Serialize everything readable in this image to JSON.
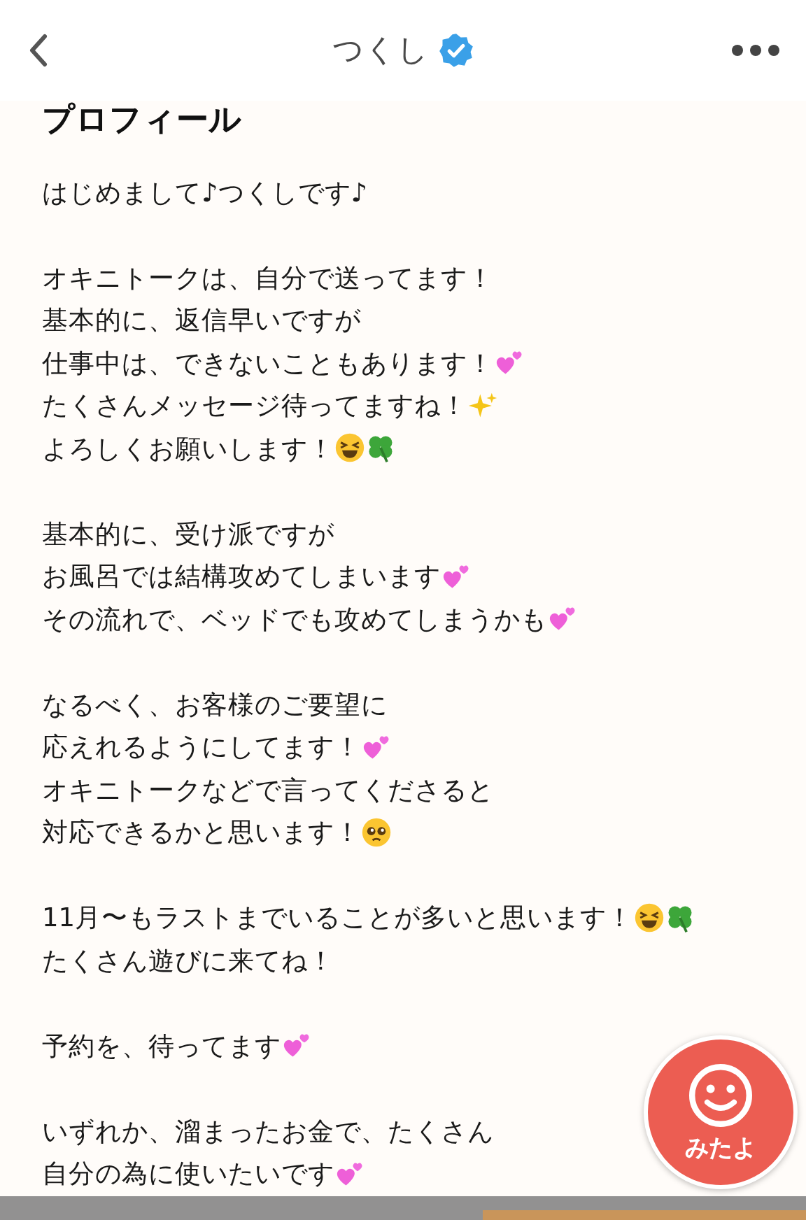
{
  "header": {
    "title": "つくし",
    "verified": true
  },
  "profile": {
    "heading": "プロフィール",
    "paragraphs": [
      [
        {
          "text": "はじめまして♪つくしです♪"
        }
      ],
      [
        {
          "text": "オキニトークは、自分で送ってます！"
        },
        {
          "text": "基本的に、返信早いですが"
        },
        {
          "text": "仕事中は、できないこともあります！",
          "icons": [
            {
              "kind": "hearts"
            }
          ]
        },
        {
          "text": "たくさんメッセージ待ってますね！",
          "icons": [
            {
              "kind": "sparkles"
            }
          ]
        },
        {
          "text": "よろしくお願いします！",
          "icons": [
            {
              "kind": "laugh"
            },
            {
              "kind": "clover"
            }
          ]
        }
      ],
      [
        {
          "text": "基本的に、受け派ですが"
        },
        {
          "text": "お風呂では結構攻めてしまいます",
          "icons": [
            {
              "kind": "hearts"
            }
          ]
        },
        {
          "text": "その流れで、ベッドでも攻めてしまうかも",
          "icons": [
            {
              "kind": "hearts"
            }
          ]
        }
      ],
      [
        {
          "text": "なるべく、お客様のご要望に"
        },
        {
          "text": "応えれるようにしてます！",
          "icons": [
            {
              "kind": "hearts"
            }
          ]
        },
        {
          "text": "オキニトークなどで言ってくださると"
        },
        {
          "text": "対応できるかと思います！",
          "icons": [
            {
              "kind": "pleading"
            }
          ]
        }
      ],
      [
        {
          "text": "11月〜もラストまでいることが多いと思います！",
          "icons": [
            {
              "kind": "laugh"
            },
            {
              "kind": "clover"
            }
          ]
        },
        {
          "text": "たくさん遊びに来てね！"
        }
      ],
      [
        {
          "text": "予約を、待ってます",
          "icons": [
            {
              "kind": "hearts"
            }
          ]
        }
      ],
      [
        {
          "text": "いずれか、溜まったお金で、たくさん"
        },
        {
          "text": "自分の為に使いたいです",
          "icons": [
            {
              "kind": "hearts"
            }
          ]
        }
      ]
    ]
  },
  "fab": {
    "label": "みたよ"
  }
}
